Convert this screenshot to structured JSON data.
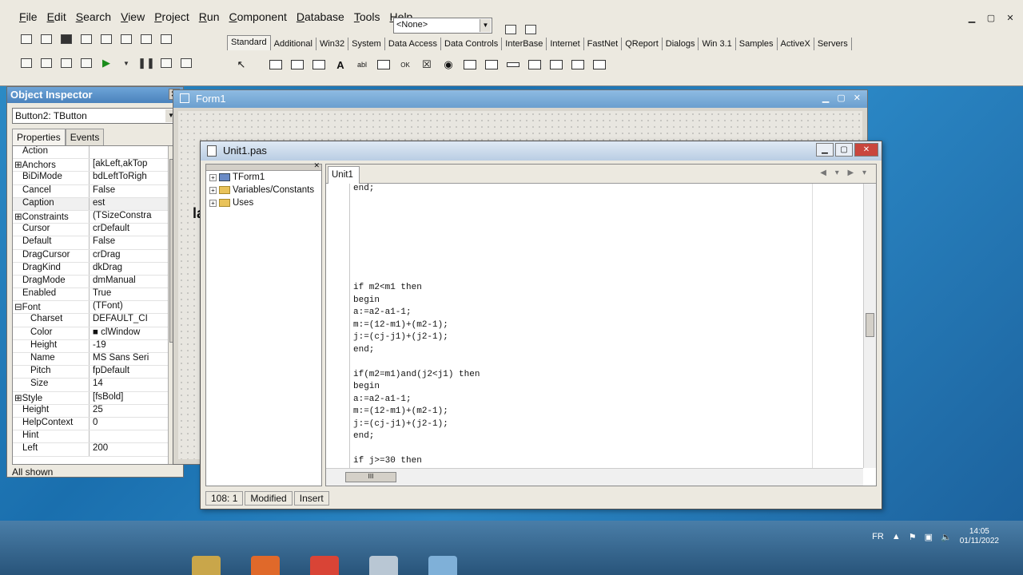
{
  "menu": [
    "File",
    "Edit",
    "Search",
    "View",
    "Project",
    "Run",
    "Component",
    "Database",
    "Tools",
    "Help"
  ],
  "config_combo": "<None>",
  "palette_tabs": [
    "Standard",
    "Additional",
    "Win32",
    "System",
    "Data Access",
    "Data Controls",
    "InterBase",
    "Internet",
    "FastNet",
    "QReport",
    "Dialogs",
    "Win 3.1",
    "Samples",
    "ActiveX",
    "Servers"
  ],
  "object_inspector": {
    "title": "Object Inspector",
    "selected_object": "Button2: TButton",
    "tabs": [
      "Properties",
      "Events"
    ],
    "properties": [
      {
        "name": "Action",
        "value": ""
      },
      {
        "name": "⊞Anchors",
        "value": "[akLeft,akTop"
      },
      {
        "name": "BiDiMode",
        "value": "bdLeftToRigh"
      },
      {
        "name": "Cancel",
        "value": "False"
      },
      {
        "name": "Caption",
        "value": "est"
      },
      {
        "name": "⊞Constraints",
        "value": "(TSizeConstra"
      },
      {
        "name": "Cursor",
        "value": "crDefault"
      },
      {
        "name": "Default",
        "value": "False"
      },
      {
        "name": "DragCursor",
        "value": "crDrag"
      },
      {
        "name": "DragKind",
        "value": "dkDrag"
      },
      {
        "name": "DragMode",
        "value": "dmManual"
      },
      {
        "name": "Enabled",
        "value": "True"
      },
      {
        "name": "⊟Font",
        "value": "(TFont)"
      },
      {
        "name": "Charset",
        "value": "DEFAULT_CI"
      },
      {
        "name": "Color",
        "value": "■ clWindow"
      },
      {
        "name": "Height",
        "value": "-19"
      },
      {
        "name": "Name",
        "value": "MS Sans Seri"
      },
      {
        "name": "Pitch",
        "value": "fpDefault"
      },
      {
        "name": "Size",
        "value": "14"
      },
      {
        "name": "⊞Style",
        "value": "[fsBold]"
      },
      {
        "name": "Height",
        "value": "25"
      },
      {
        "name": "HelpContext",
        "value": "0"
      },
      {
        "name": "Hint",
        "value": ""
      },
      {
        "name": "Left",
        "value": "200"
      }
    ],
    "status": "All shown"
  },
  "form1": {
    "title": "Form1",
    "label": "la"
  },
  "editor": {
    "title": "Unit1.pas",
    "tree": [
      "TForm1",
      "Variables/Constants",
      "Uses"
    ],
    "tab": "Unit1",
    "code_lines": [
      "end;",
      "",
      "",
      "",
      "",
      "",
      "",
      "",
      "if m2<m1 then",
      "begin",
      "a:=a2-a1-1;",
      "m:=(12-m1)+(m2-1);",
      "j:=(cj-j1)+(j2-1);",
      "end;",
      "",
      "if(m2=m1)and(j2<j1) then",
      "begin",
      "a:=a2-a1-1;",
      "m:=(12-m1)+(m2-1);",
      "j:=(cj-j1)+(j2-1);",
      "end;",
      "",
      "if j>=30 then"
    ],
    "status": {
      "position": "108:  1",
      "modified": "Modified",
      "mode": "Insert"
    }
  },
  "tray": {
    "lang": "FR",
    "time": "14:05",
    "date": "01/11/2022"
  }
}
